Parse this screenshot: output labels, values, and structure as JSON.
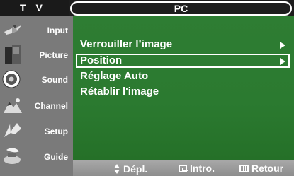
{
  "header": {
    "source_label": "T V",
    "title": "PC"
  },
  "sidebar": {
    "items": [
      {
        "label": "Input",
        "icon": "input-icon"
      },
      {
        "label": "Picture",
        "icon": "picture-icon"
      },
      {
        "label": "Sound",
        "icon": "sound-icon"
      },
      {
        "label": "Channel",
        "icon": "channel-icon"
      },
      {
        "label": "Setup",
        "icon": "setup-icon"
      },
      {
        "label": "Guide",
        "icon": "guide-icon"
      }
    ],
    "active_index": 1
  },
  "menu": {
    "items": [
      {
        "label": "Verrouiller l’image",
        "has_submenu": true
      },
      {
        "label": "Position",
        "has_submenu": true,
        "selected": true
      },
      {
        "label": "Réglage Auto",
        "has_submenu": false
      },
      {
        "label": "Rétablir l'image",
        "has_submenu": false
      }
    ]
  },
  "footer": {
    "move_label": "Dépl.",
    "enter_label": "Intro.",
    "return_label": "Retour"
  },
  "colors": {
    "content_bg": "#2e7d33",
    "sidebar_bg": "#7a7a7a",
    "footer_bg": "#9a9a9a"
  }
}
